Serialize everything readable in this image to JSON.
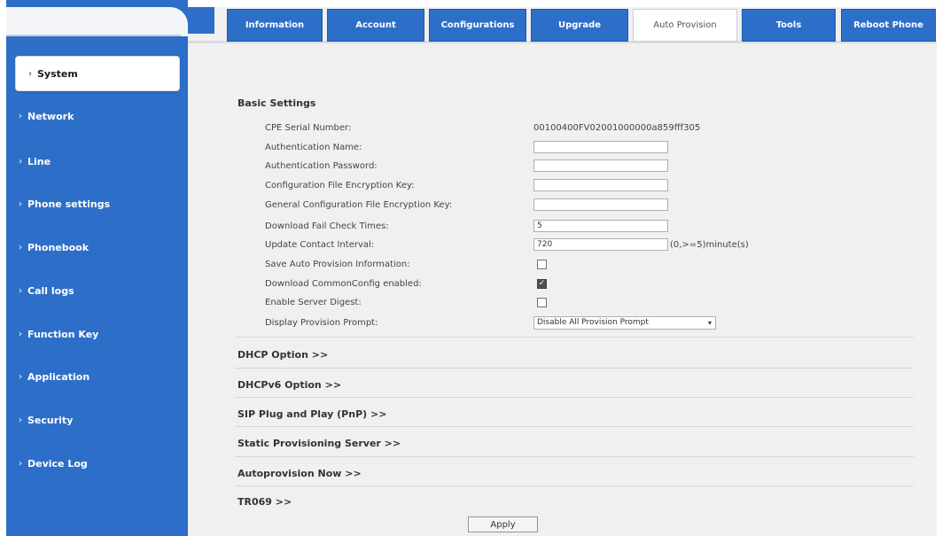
{
  "sidebar": {
    "items": [
      {
        "label": "System",
        "active": true
      },
      {
        "label": "Network"
      },
      {
        "label": "Line"
      },
      {
        "label": "Phone settings"
      },
      {
        "label": "Phonebook"
      },
      {
        "label": "Call logs"
      },
      {
        "label": "Function Key"
      },
      {
        "label": "Application"
      },
      {
        "label": "Security"
      },
      {
        "label": "Device Log"
      }
    ],
    "chevron": "›"
  },
  "tabs": [
    {
      "label": "Information"
    },
    {
      "label": "Account"
    },
    {
      "label": "Configurations"
    },
    {
      "label": "Upgrade"
    },
    {
      "label": "Auto Provision",
      "active": true
    },
    {
      "label": "Tools"
    },
    {
      "label": "Reboot Phone"
    }
  ],
  "basic_settings": {
    "title": "Basic Settings",
    "cpe_serial_label": "CPE Serial Number:",
    "cpe_serial_value": "00100400FV02001000000a859fff305",
    "auth_name_label": "Authentication Name:",
    "auth_name_value": "",
    "auth_password_label": "Authentication Password:",
    "auth_password_value": "",
    "config_key_label": "Configuration File Encryption Key:",
    "config_key_value": "",
    "general_key_label": "General Configuration File Encryption Key:",
    "general_key_value": "",
    "fail_check_label": "Download Fail Check Times:",
    "fail_check_value": "5",
    "contact_interval_label": "Update Contact Interval:",
    "contact_interval_value": "720",
    "contact_interval_unit": "(0,>=5)minute(s)",
    "save_info_label": "Save Auto Provision Information:",
    "save_info_checked": false,
    "common_config_label": "Download CommonConfig enabled:",
    "common_config_checked": true,
    "server_digest_label": "Enable Server Digest:",
    "server_digest_checked": false,
    "prompt_label": "Display Provision Prompt:",
    "prompt_value": "Disable All Provision Prompt"
  },
  "sections": {
    "dhcp": "DHCP Option >>",
    "dhcpv6": "DHCPv6 Option >>",
    "pnp": "SIP Plug and Play (PnP) >>",
    "static": "Static Provisioning Server >>",
    "autoprov": "Autoprovision Now >>",
    "tr069": "TR069 >>"
  },
  "apply_label": "Apply",
  "colors": {
    "sidebar": "#2d6fc8",
    "content_bg": "#f0f0f0",
    "tab_active_bg": "#ffffff"
  },
  "icons": {
    "checkbox_checked_mark": "✓",
    "dropdown_caret": "▾"
  }
}
